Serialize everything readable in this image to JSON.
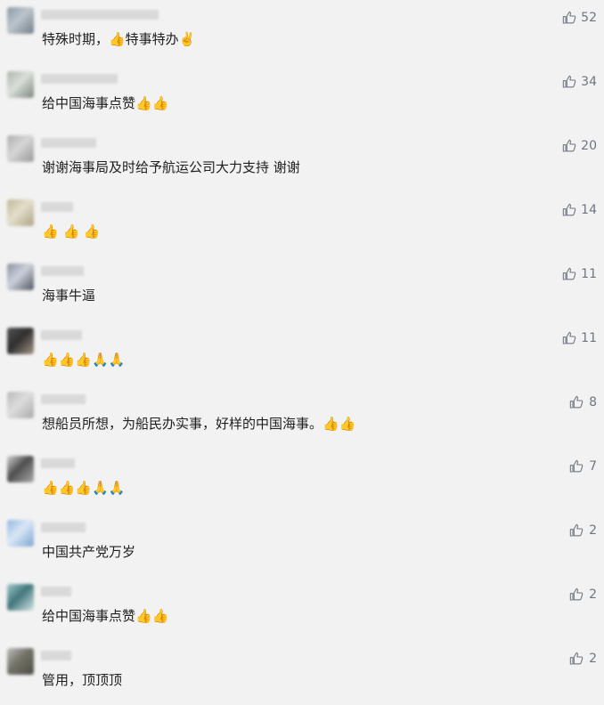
{
  "comments": [
    {
      "text": "特殊时期，👍特事特办✌️",
      "likes": "52"
    },
    {
      "text": "给中国海事点赞👍👍",
      "likes": "34"
    },
    {
      "text": "谢谢海事局及时给予航运公司大力支持 谢谢",
      "likes": "20"
    },
    {
      "text": "👍 👍 👍",
      "likes": "14"
    },
    {
      "text": "海事牛逼",
      "likes": "11"
    },
    {
      "text": "👍👍👍🙏🙏",
      "likes": "11"
    },
    {
      "text": "想船员所想，为船民办实事，好样的中国海事。👍👍",
      "likes": "8"
    },
    {
      "text": "👍👍👍🙏🙏",
      "likes": "7"
    },
    {
      "text": "中国共产党万岁",
      "likes": "2"
    },
    {
      "text": "给中国海事点赞👍👍",
      "likes": "2"
    },
    {
      "text": "管用，顶顶顶",
      "likes": "2"
    }
  ],
  "colors": {
    "background": "#f2f2f2",
    "text": "#202020",
    "like_icon": "#6f7680",
    "username_placeholder": "#d9d9d9"
  },
  "icons": {
    "like": "thumb-up-icon"
  }
}
